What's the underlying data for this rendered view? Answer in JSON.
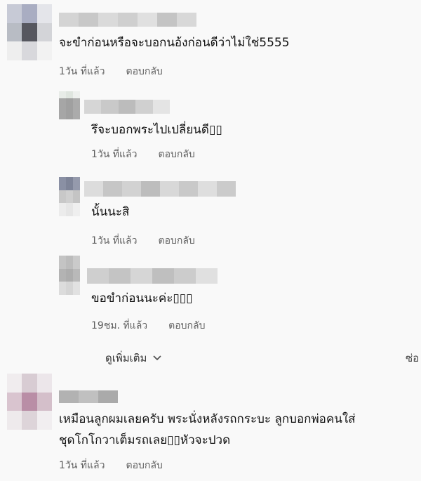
{
  "colors": {
    "background": "#f9f9f9",
    "text": "#111111",
    "meta": "#606060"
  },
  "comments": [
    {
      "text": "จะขำก่อนหรือจะบอกนอ้งก่อนดีว่าไม่ใช่5555",
      "time": "1วัน ที่แล้ว",
      "reply": "ตอบกลับ"
    },
    {
      "text": "รึจะบอกพระไปเปลี่ยนดี▯▯",
      "time": "1วัน ที่แล้ว",
      "reply": "ตอบกลับ"
    },
    {
      "text": "นั้นนะสิ",
      "time": "1วัน ที่แล้ว",
      "reply": "ตอบกลับ"
    },
    {
      "text": "ขอขำก่อนนะค่ะ▯▯▯",
      "time": "19ชม. ที่แล้ว",
      "reply": "ตอบกลับ"
    },
    {
      "text_line1": "เหมือนลูกผมเลยครับ พระนั่งหลังรถกระบะ ลูกบอกพ่อคนใส่",
      "text_line2": "ชุดโกโกวาเต็มรถเลย▯▯หัวจะปวด",
      "time": "1วัน ที่แล้ว",
      "reply": "ตอบกลับ"
    }
  ],
  "more_replies": {
    "label": "ดูเพิ่มเติม",
    "icon": "chevron-down-icon"
  },
  "edge_text": "ซ่อ"
}
